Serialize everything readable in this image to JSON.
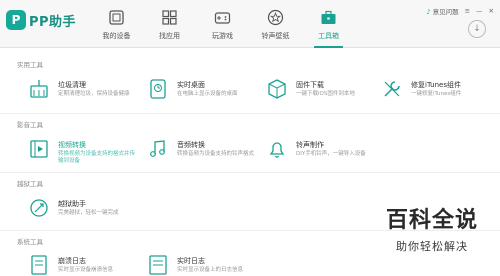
{
  "app": {
    "logo_mark": "P",
    "logo_text": "PP助手"
  },
  "nav": [
    {
      "label": "我的设备",
      "icon": "device-icon"
    },
    {
      "label": "找应用",
      "icon": "apps-icon"
    },
    {
      "label": "玩游戏",
      "icon": "gamepad-icon"
    },
    {
      "label": "铃声壁纸",
      "icon": "star-icon"
    },
    {
      "label": "工具箱",
      "icon": "toolbox-icon",
      "active": true
    }
  ],
  "window": {
    "feedback": "意见问题"
  },
  "accent": "#1aa192",
  "sections": {
    "utility": "实用工具",
    "media": "影音工具",
    "jailbreak": "越狱工具",
    "system": "系统工具"
  },
  "tools": {
    "clean": {
      "name": "垃圾清理",
      "desc": "定期清理垃圾，保持设备健康",
      "icon": "broom-icon"
    },
    "desktop": {
      "name": "实时桌面",
      "desc": "在电脑上显示设备的桌面",
      "icon": "desktop-icon"
    },
    "firmware": {
      "name": "固件下载",
      "desc": "一键下载iOS固件到本地",
      "icon": "box-icon"
    },
    "itunes": {
      "name": "修复iTunes组件",
      "desc": "一键修复iTunes组件",
      "icon": "wrench-icon"
    },
    "video": {
      "name": "视频转换",
      "desc": "转换视频为设备支持的格式并传输到设备",
      "icon": "film-icon"
    },
    "audio": {
      "name": "音频转换",
      "desc": "转换音频为设备支持的铃声格式",
      "icon": "music-icon"
    },
    "ringtone": {
      "name": "铃声制作",
      "desc": "DIY手机铃声，一键导入设备",
      "icon": "bell-icon"
    },
    "jailbreak": {
      "name": "越狱助手",
      "desc": "完美越狱，轻松一键完成",
      "icon": "jailbreak-icon"
    },
    "crashlog": {
      "name": "崩溃日志",
      "desc": "实时显示设备崩溃信息",
      "icon": "doc-icon"
    },
    "realtimelog": {
      "name": "实时日志",
      "desc": "实时显示设备上的日志信息",
      "icon": "log-icon"
    }
  },
  "watermark": {
    "big": "百科全说",
    "small": "助你轻松解决"
  }
}
